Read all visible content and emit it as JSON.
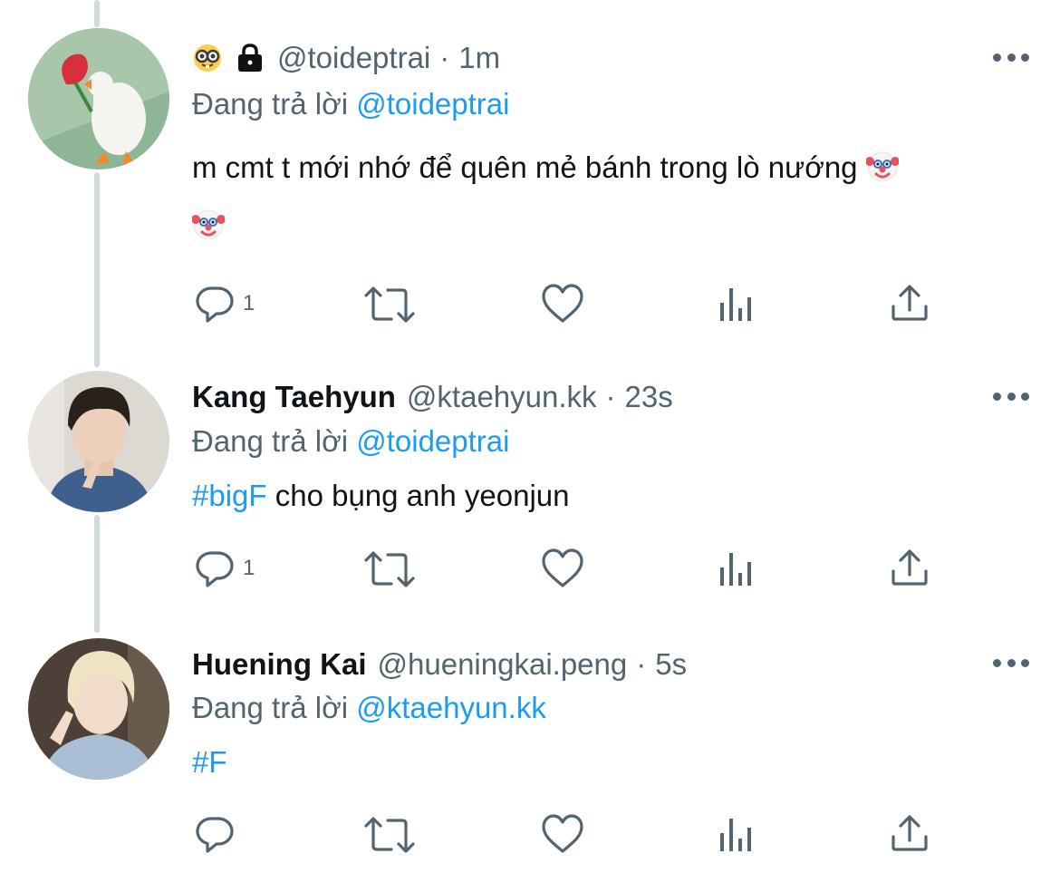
{
  "tweets": [
    {
      "name": "",
      "handle": "@toideptrai",
      "time": "1m",
      "reply_prefix": "Đang trả lời",
      "reply_to": "@toideptrai",
      "text": "m cmt t mới nhớ để quên mẻ bánh trong lò nướng",
      "reply_count": "1",
      "avatar": "goose-with-rose-avatar",
      "badges": [
        "nerd-face-emoji",
        "lock-icon"
      ]
    },
    {
      "name": "Kang Taehyun",
      "handle": "@ktaehyun.kk",
      "time": "23s",
      "reply_prefix": "Đang trả lời",
      "reply_to": "@toideptrai",
      "hashtag": "#bigF",
      "text": " cho bụng anh yeonjun",
      "reply_count": "1",
      "avatar": "person-avatar"
    },
    {
      "name": "Huening Kai",
      "handle": "@hueningkai.peng",
      "time": "5s",
      "reply_prefix": "Đang trả lời",
      "reply_to": "@ktaehyun.kk",
      "hashtag": "#F",
      "reply_count": "",
      "avatar": "person-avatar"
    }
  ],
  "separator": "·",
  "colors": {
    "link": "#1d9bf0",
    "secondary": "#536471",
    "text": "#0f1419",
    "thread_line": "#cfd9de"
  },
  "icons": [
    "reply-icon",
    "retweet-icon",
    "like-icon",
    "views-icon",
    "share-icon",
    "more-icon",
    "clown-face-emoji"
  ]
}
